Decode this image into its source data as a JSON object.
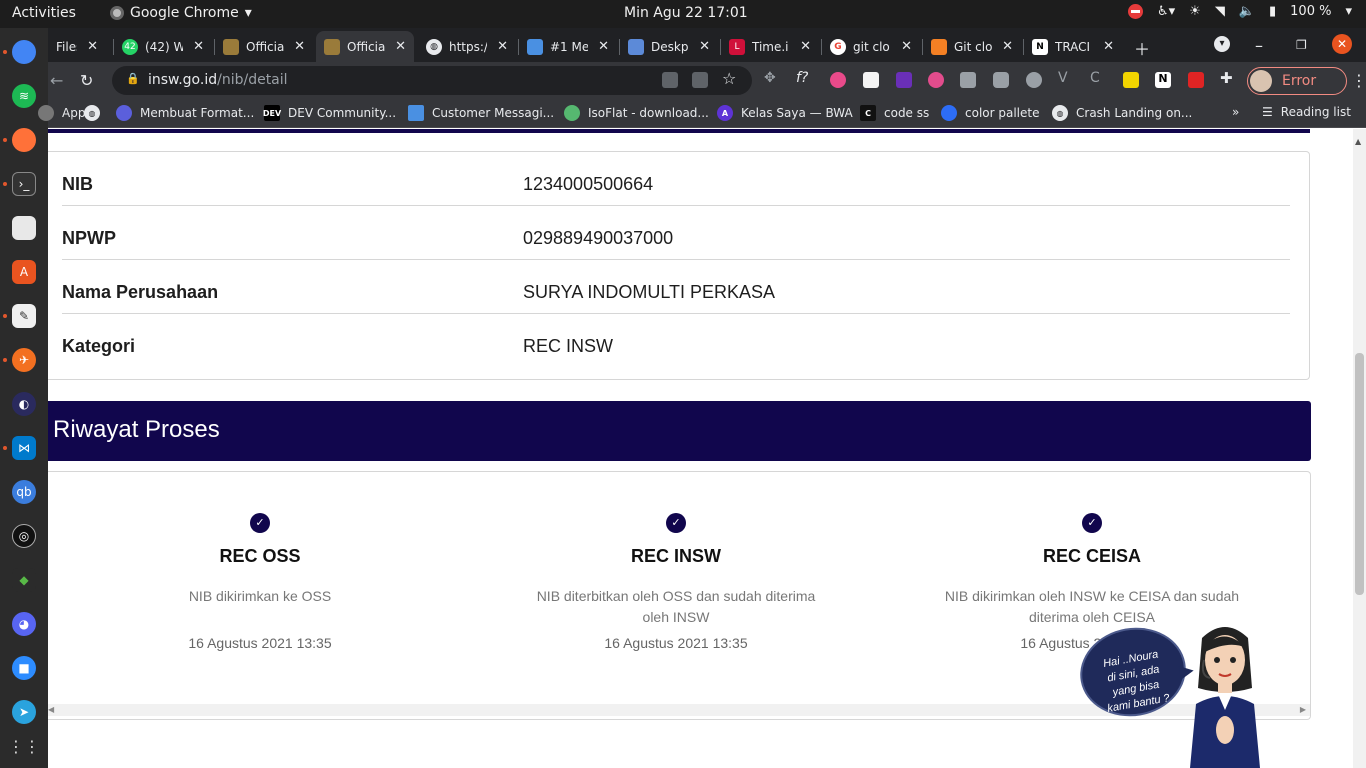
{
  "system": {
    "activities": "Activities",
    "app_name": "Google Chrome",
    "clock": "Min Agu 22  17:01",
    "battery": "100 %"
  },
  "tabs": [
    {
      "label": "Files - ",
      "favicon": "drive-icon",
      "color": "#4285f4",
      "active": false
    },
    {
      "label": "(42) W",
      "favicon": "whatsapp-icon",
      "color": "#25d366",
      "active": false
    },
    {
      "label": "Officia",
      "favicon": "garuda-icon",
      "color": "#9a7b3a",
      "active": false
    },
    {
      "label": "Officia",
      "favicon": "garuda-icon",
      "color": "#9a7b3a",
      "active": true
    },
    {
      "label": "https:/",
      "favicon": "globe-icon",
      "color": "#9aa0a6",
      "active": false
    },
    {
      "label": "#1 Me",
      "favicon": "meet-icon",
      "color": "#4a90e2",
      "active": false
    },
    {
      "label": "Deskp",
      "favicon": "desktop-icon",
      "color": "#5c8ad8",
      "active": false
    },
    {
      "label": "Time.i",
      "favicon": "time-icon",
      "color": "#d0103a",
      "active": false
    },
    {
      "label": "git clo",
      "favicon": "google-icon",
      "color": "#ea4335",
      "active": false
    },
    {
      "label": "Git clo",
      "favicon": "stackoverflow-icon",
      "color": "#f48024",
      "active": false
    },
    {
      "label": "TRACI",
      "favicon": "notion-icon",
      "color": "#ffffff",
      "active": false
    }
  ],
  "omnibox": {
    "domain": "insw.go.id",
    "path": "/nib/detail"
  },
  "profile": {
    "label": "Error"
  },
  "bookmarks": [
    {
      "label": "Apps",
      "icon": "apps-icon",
      "color": "#777777"
    },
    {
      "label": "",
      "icon": "globe-icon",
      "color": "#9aa0a6"
    },
    {
      "label": "Membuat Format...",
      "icon": "membuat-icon",
      "color": "#5b5fdc"
    },
    {
      "label": "DEV Community...",
      "icon": "dev-icon",
      "color": "#000000"
    },
    {
      "label": "Customer Messagi...",
      "icon": "message-icon",
      "color": "#4a90e2"
    },
    {
      "label": "IsoFlat - download...",
      "icon": "isoflat-icon",
      "color": "#56b870"
    },
    {
      "label": "Kelas Saya — BWA",
      "icon": "bwa-icon",
      "color": "#5e33d6"
    },
    {
      "label": "code ss",
      "icon": "carbon-icon",
      "color": "#111111"
    },
    {
      "label": "color pallete",
      "icon": "coolors-icon",
      "color": "#2d6df6"
    },
    {
      "label": "Crash Landing on...",
      "icon": "globe-icon",
      "color": "#9aa0a6"
    }
  ],
  "bookmarks_overflow": "»",
  "reading_list": "Reading list",
  "company": {
    "rows": [
      {
        "label": "NIB",
        "value": "1234000500664"
      },
      {
        "label": "NPWP",
        "value": "029889490037000"
      },
      {
        "label": "Nama Perusahaan",
        "value": "SURYA INDOMULTI PERKASA"
      },
      {
        "label": "Kategori",
        "value": "REC INSW"
      }
    ]
  },
  "riwayat": {
    "title": "Riwayat Proses",
    "steps": [
      {
        "title": "REC OSS",
        "description": "NIB dikirimkan ke OSS",
        "date": "16 Agustus 2021 13:35"
      },
      {
        "title": "REC INSW",
        "description": "NIB diterbitkan oleh OSS dan sudah diterima oleh INSW",
        "date": "16 Agustus 2021 13:35"
      },
      {
        "title": "REC CEISA",
        "description": "NIB dikirimkan oleh INSW ke CEISA dan sudah diterima oleh CEISA",
        "date": "16 Agustus 2021 13:35"
      }
    ]
  },
  "chat": {
    "bubble": "Hai ..Noura\ndi sini, ada\nyang bisa\nkami bantu ?"
  },
  "colors": {
    "brand_navy": "#11064d",
    "chrome_dark": "#202124",
    "chrome_toolbar": "#35363a",
    "error_red": "#f28b82"
  }
}
